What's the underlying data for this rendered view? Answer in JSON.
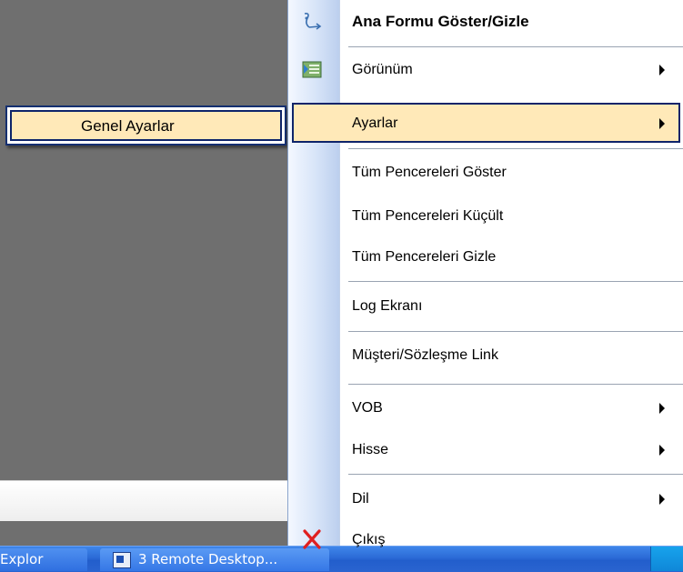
{
  "taskbar": {
    "explorer_label": "Explor",
    "remote_label": "3 Remote Desktop..."
  },
  "submenu": {
    "items": [
      {
        "label": "Genel Ayarlar"
      }
    ]
  },
  "menu": {
    "items": [
      {
        "label": "Ana Formu Göster/Gizle",
        "icon": "form-toggle-icon"
      },
      {
        "label": "Görünüm",
        "icon": "view-icon",
        "has_submenu": true
      },
      {
        "label": "Ayarlar",
        "has_submenu": true,
        "selected": true
      },
      {
        "label": "Tüm Pencereleri Göster"
      },
      {
        "label": "Tüm Pencereleri Küçült"
      },
      {
        "label": "Tüm Pencereleri Gizle"
      },
      {
        "label": "Log Ekranı"
      },
      {
        "label": "Müşteri/Sözleşme Link"
      },
      {
        "label": "VOB",
        "has_submenu": true
      },
      {
        "label": "Hisse",
        "has_submenu": true
      },
      {
        "label": "Dil",
        "has_submenu": true
      },
      {
        "label": "Çıkış",
        "icon": "exit-x-icon"
      }
    ]
  },
  "colors": {
    "highlight": "#ffe9b8",
    "highlight_border": "#0e246a",
    "menu_strip": "#d7e4f8",
    "exit_icon": "#e02020"
  }
}
